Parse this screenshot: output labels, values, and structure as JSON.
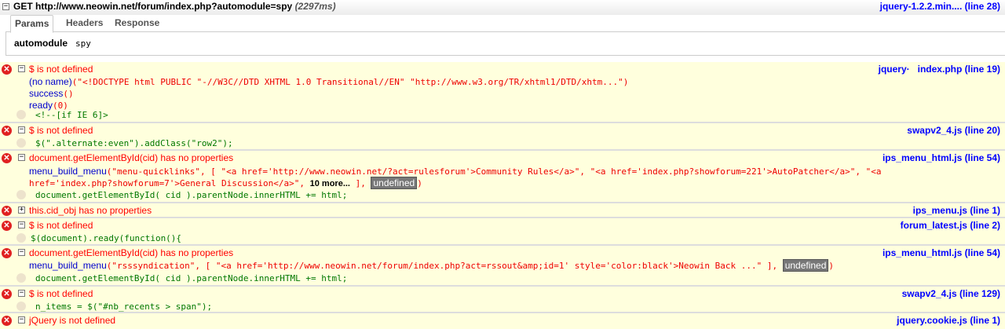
{
  "request": {
    "method_url": "GET http://www.neowin.net/forum/index.php?automodule=spy",
    "time": "(2297ms)",
    "source": "jquery-1.2.2.min.... (line 28)"
  },
  "tabs": [
    "Params",
    "Headers",
    "Response"
  ],
  "params": {
    "key": "automodule",
    "value": "spy"
  },
  "errors": [
    {
      "message": "$ is not defined",
      "source_prefix": "jquery·",
      "source": "index.php (line 19)",
      "stack": [
        {
          "fn": "(no name)",
          "args": "(\"<!DOCTYPE html PUBLIC \"-//W3C//DTD XHTML 1.0 Transitional//EN\" \"http://www.w3.org/TR/xhtml1/DTD/xhtm...\")"
        },
        {
          "fn": "success",
          "args": "()"
        },
        {
          "fn": "ready",
          "args": "(0)"
        }
      ],
      "code": "<!--[if IE 6]>"
    },
    {
      "message": "$ is not defined",
      "source": "swapv2_4.js (line 20)",
      "code": "$(\".alternate:even\").addClass(\"row2\");"
    },
    {
      "message": "document.getElementById(cid) has no properties",
      "source": "ips_menu_html.js (line 54)",
      "stack": [
        {
          "fn": "menu_build_menu",
          "args": "(\"menu-quicklinks\", [ \"<a href='http://www.neowin.net/?act=rulesforum'>Community Rules</a>\", \"<a href='index.php?showforum=221'>AutoPatcher</a>\", \"<a",
          "args2": "href='index.php?showforum=7'>General Discussion</a>\", ",
          "more": "10 more...",
          "after": " ], ",
          "undef": "undefined",
          "close": ")"
        }
      ],
      "code": "document.getElementById( cid ).parentNode.innerHTML += html;"
    },
    {
      "message": "this.cid_obj has no properties",
      "source": "ips_menu.js (line 1)"
    },
    {
      "message": "$ is not defined",
      "source": "forum_latest.js (line 2)",
      "code": "$(document).ready(function(){"
    },
    {
      "message": "document.getElementById(cid) has no properties",
      "source": "ips_menu_html.js (line 54)",
      "stack": [
        {
          "fn": "menu_build_menu",
          "args": "(\"rsssyndication\", [ \"<a href='http://www.neowin.net/forum/index.php?act=rssout&amp;id=1' style='color:black'>Neowin Back ...\" ], ",
          "undef": "undefined",
          "close": ")"
        }
      ],
      "code": "document.getElementById( cid ).parentNode.innerHTML += html;"
    },
    {
      "message": "$ is not defined",
      "source": "swapv2_4.js (line 129)",
      "code": "n_items = $(\"#nb_recents > span\");"
    },
    {
      "message": "jQuery is not defined",
      "source": "jquery.cookie.js (line 1)"
    }
  ],
  "icons": {
    "error": "error-x-icon",
    "collapse": "minus-box-icon",
    "expand": "plus-box-icon",
    "breakpoint": "breakpoint-icon"
  }
}
